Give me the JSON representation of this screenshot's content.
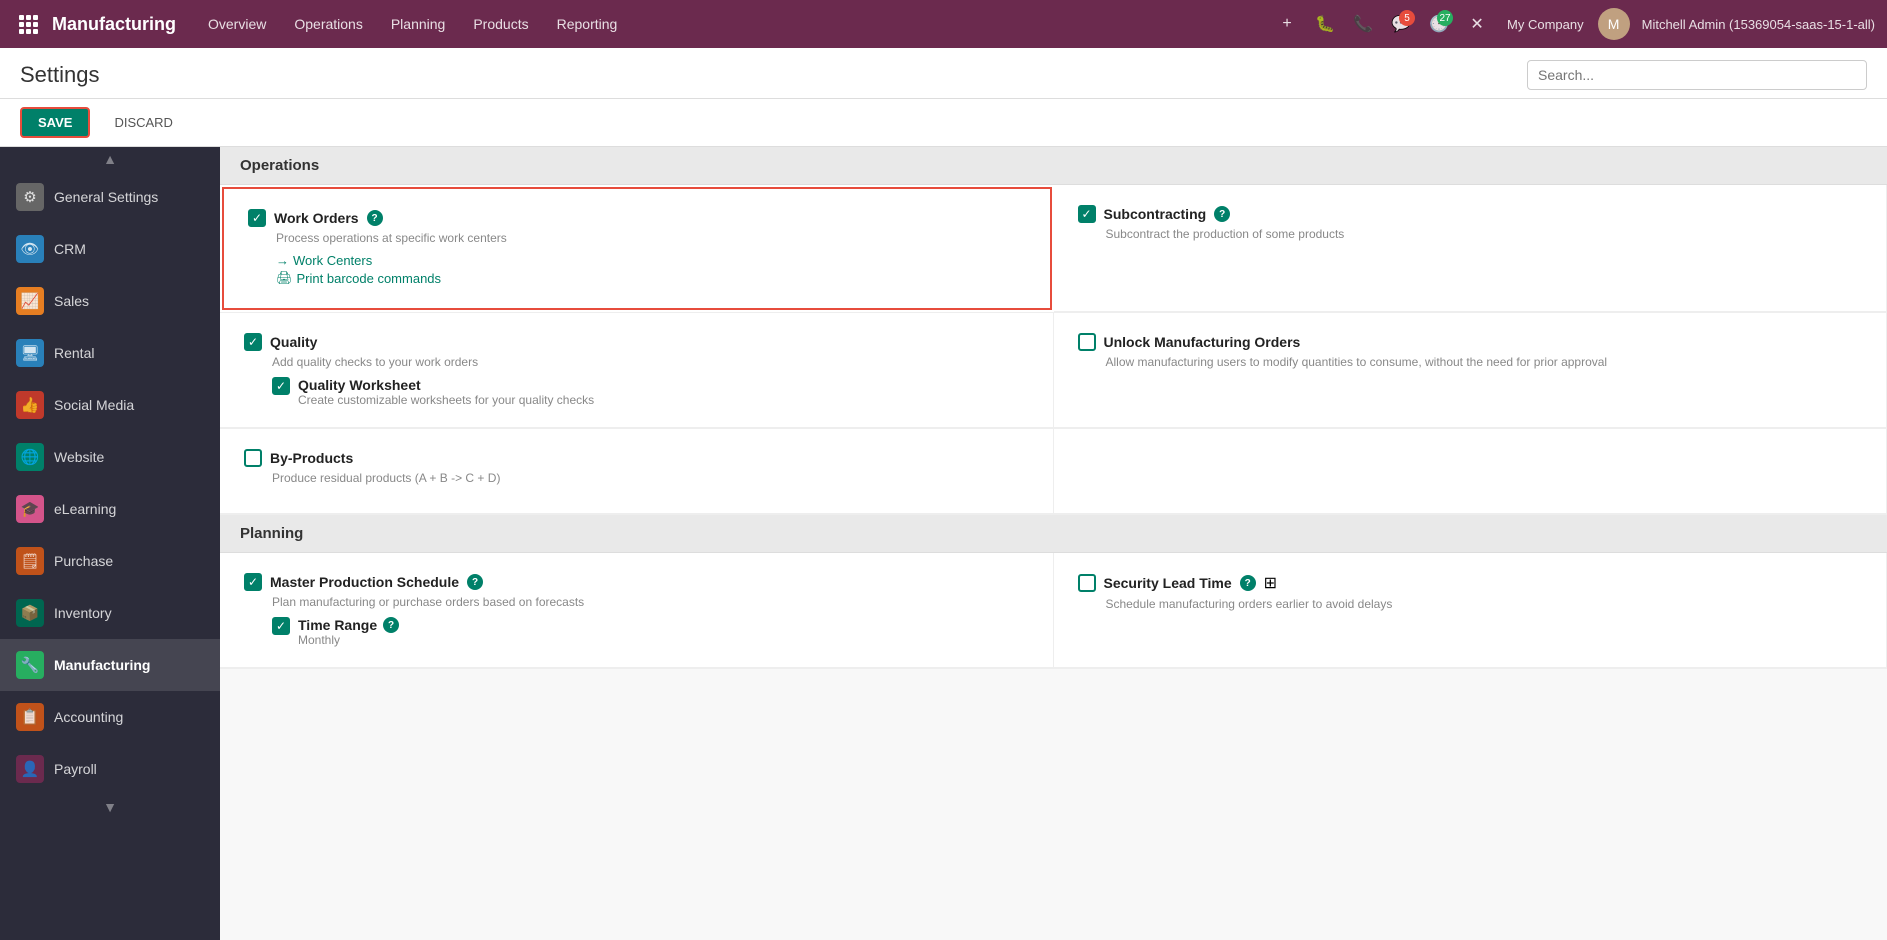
{
  "app": {
    "brand": "Manufacturing",
    "nav_links": [
      "Overview",
      "Operations",
      "Planning",
      "Products",
      "Reporting"
    ],
    "plus_btn": "+",
    "notifications": {
      "bug_count": "",
      "phone": "",
      "chat_count": "5",
      "clock_count": "27"
    },
    "company": "My Company",
    "user": "Mitchell Admin (15369054-saas-15-1-all)",
    "avatar_initials": "M"
  },
  "page": {
    "title": "Settings",
    "search_placeholder": "Search..."
  },
  "toolbar": {
    "save_label": "SAVE",
    "discard_label": "DISCARD"
  },
  "sidebar": {
    "items": [
      {
        "id": "general",
        "label": "General Settings",
        "icon": "⚙",
        "color": "gray"
      },
      {
        "id": "crm",
        "label": "CRM",
        "icon": "👁",
        "color": "blue"
      },
      {
        "id": "sales",
        "label": "Sales",
        "icon": "📈",
        "color": "orange"
      },
      {
        "id": "rental",
        "label": "Rental",
        "icon": "🖥",
        "color": "blue"
      },
      {
        "id": "social",
        "label": "Social Media",
        "icon": "👍",
        "color": "red"
      },
      {
        "id": "website",
        "label": "Website",
        "icon": "🌐",
        "color": "teal"
      },
      {
        "id": "elearning",
        "label": "eLearning",
        "icon": "🎓",
        "color": "pink"
      },
      {
        "id": "purchase",
        "label": "Purchase",
        "icon": "🗒",
        "color": "dark-orange"
      },
      {
        "id": "inventory",
        "label": "Inventory",
        "icon": "📦",
        "color": "dark-teal"
      },
      {
        "id": "manufacturing",
        "label": "Manufacturing",
        "icon": "🔧",
        "color": "green",
        "active": true
      },
      {
        "id": "accounting",
        "label": "Accounting",
        "icon": "📋",
        "color": "dark-orange"
      },
      {
        "id": "payroll",
        "label": "Payroll",
        "icon": "👤",
        "color": "purple"
      }
    ]
  },
  "sections": [
    {
      "id": "operations",
      "title": "Operations",
      "settings": [
        {
          "id": "work_orders",
          "title": "Work Orders",
          "has_help": true,
          "checked": true,
          "highlighted": true,
          "desc": "Process operations at specific work centers",
          "links": [
            {
              "label": "Work Centers",
              "icon": "→"
            },
            {
              "label": "Print barcode commands",
              "icon": "🖨"
            }
          ]
        },
        {
          "id": "subcontracting",
          "title": "Subcontracting",
          "has_help": true,
          "checked": true,
          "highlighted": false,
          "desc": "Subcontract the production of some products",
          "links": []
        },
        {
          "id": "quality",
          "title": "Quality",
          "has_help": false,
          "checked": true,
          "highlighted": false,
          "desc": "Add quality checks to your work orders",
          "links": [],
          "sub_settings": [
            {
              "id": "quality_worksheet",
              "title": "Quality Worksheet",
              "checked": true,
              "desc": "Create customizable worksheets for your quality checks"
            }
          ]
        },
        {
          "id": "unlock_manufacturing",
          "title": "Unlock Manufacturing Orders",
          "has_help": false,
          "checked": false,
          "highlighted": false,
          "desc": "Allow manufacturing users to modify quantities to consume, without the need for prior approval",
          "links": []
        },
        {
          "id": "by_products",
          "title": "By-Products",
          "has_help": false,
          "checked": false,
          "highlighted": false,
          "desc": "Produce residual products (A + B -> C + D)",
          "links": []
        },
        {
          "id": "empty",
          "title": "",
          "empty": true
        }
      ]
    },
    {
      "id": "planning",
      "title": "Planning",
      "settings": [
        {
          "id": "master_production",
          "title": "Master Production Schedule",
          "has_help": true,
          "checked": true,
          "highlighted": false,
          "desc": "Plan manufacturing or purchase orders based on forecasts",
          "links": [],
          "sub_settings": [
            {
              "id": "time_range",
              "title": "Time Range",
              "has_help": true,
              "checked": true,
              "desc": "Monthly"
            }
          ]
        },
        {
          "id": "security_lead_time",
          "title": "Security Lead Time",
          "has_help": true,
          "has_grid_icon": true,
          "checked": false,
          "highlighted": false,
          "desc": "Schedule manufacturing orders earlier to avoid delays",
          "links": []
        }
      ]
    }
  ]
}
